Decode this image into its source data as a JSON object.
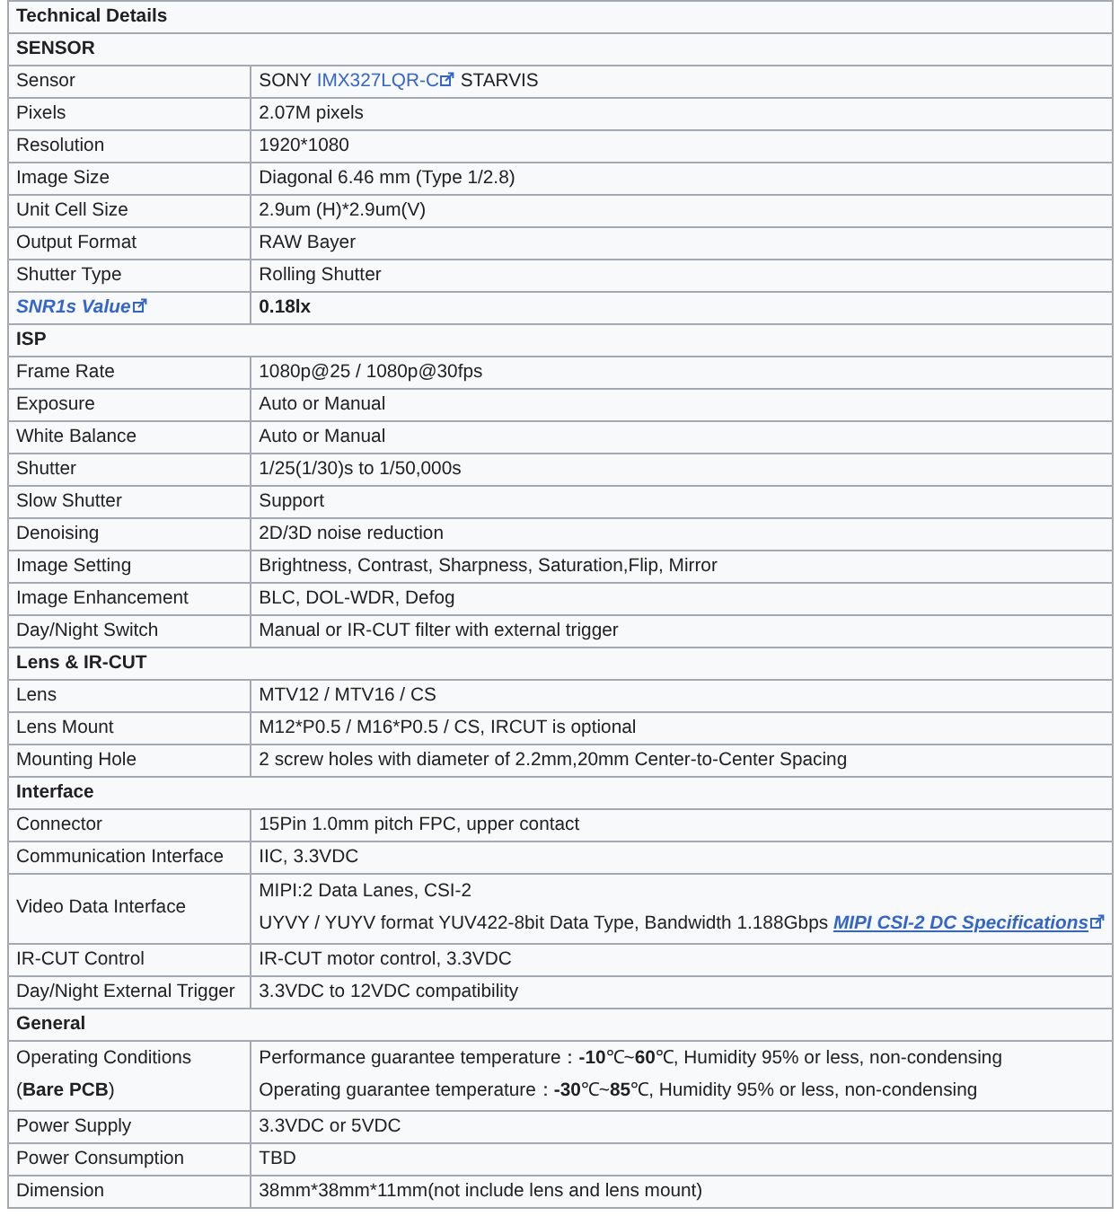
{
  "title": "Technical Details",
  "sections": [
    {
      "title": "SENSOR",
      "rows": [
        {
          "label": [
            [
              {
                "kind": "text",
                "text": "Sensor"
              }
            ]
          ],
          "value": [
            [
              {
                "kind": "text",
                "text": "SONY "
              },
              {
                "kind": "link",
                "text": "IMX327LQR-C"
              },
              {
                "kind": "text",
                "text": " STARVIS"
              }
            ]
          ]
        },
        {
          "label": [
            [
              {
                "kind": "text",
                "text": "Pixels"
              }
            ]
          ],
          "value": [
            [
              {
                "kind": "text",
                "text": "2.07M pixels"
              }
            ]
          ]
        },
        {
          "label": [
            [
              {
                "kind": "text",
                "text": "Resolution"
              }
            ]
          ],
          "value": [
            [
              {
                "kind": "text",
                "text": "1920*1080"
              }
            ]
          ]
        },
        {
          "label": [
            [
              {
                "kind": "text",
                "text": "Image Size"
              }
            ]
          ],
          "value": [
            [
              {
                "kind": "text",
                "text": "Diagonal 6.46 mm (Type 1/2.8)"
              }
            ]
          ]
        },
        {
          "label": [
            [
              {
                "kind": "text",
                "text": "Unit Cell Size"
              }
            ]
          ],
          "value": [
            [
              {
                "kind": "text",
                "text": "2.9um (H)*2.9um(V)"
              }
            ]
          ]
        },
        {
          "label": [
            [
              {
                "kind": "text",
                "text": "Output Format"
              }
            ]
          ],
          "value": [
            [
              {
                "kind": "text",
                "text": "RAW Bayer"
              }
            ]
          ]
        },
        {
          "label": [
            [
              {
                "kind": "text",
                "text": "Shutter Type"
              }
            ]
          ],
          "value": [
            [
              {
                "kind": "text",
                "text": "Rolling Shutter"
              }
            ]
          ]
        },
        {
          "label": [
            [
              {
                "kind": "link",
                "text": "SNR1s Value"
              }
            ]
          ],
          "value": [
            [
              {
                "kind": "text",
                "text": "**0.18lx**"
              }
            ]
          ]
        }
      ]
    },
    {
      "title": "ISP",
      "rows": [
        {
          "label": [
            [
              {
                "kind": "text",
                "text": "Frame Rate"
              }
            ]
          ],
          "value": [
            [
              {
                "kind": "text",
                "text": "1080p@25 / 1080p@30fps"
              }
            ]
          ]
        },
        {
          "label": [
            [
              {
                "kind": "text",
                "text": "Exposure"
              }
            ]
          ],
          "value": [
            [
              {
                "kind": "text",
                "text": "Auto or Manual"
              }
            ]
          ]
        },
        {
          "label": [
            [
              {
                "kind": "text",
                "text": "White Balance"
              }
            ]
          ],
          "value": [
            [
              {
                "kind": "text",
                "text": "Auto or Manual"
              }
            ]
          ]
        },
        {
          "label": [
            [
              {
                "kind": "text",
                "text": "Shutter"
              }
            ]
          ],
          "value": [
            [
              {
                "kind": "text",
                "text": "1/25(1/30)s to 1/50,000s"
              }
            ]
          ]
        },
        {
          "label": [
            [
              {
                "kind": "text",
                "text": "Slow Shutter"
              }
            ]
          ],
          "value": [
            [
              {
                "kind": "text",
                "text": "Support"
              }
            ]
          ]
        },
        {
          "label": [
            [
              {
                "kind": "text",
                "text": "Denoising"
              }
            ]
          ],
          "value": [
            [
              {
                "kind": "text",
                "text": "2D/3D noise reduction"
              }
            ]
          ]
        },
        {
          "label": [
            [
              {
                "kind": "text",
                "text": "Image Setting"
              }
            ]
          ],
          "value": [
            [
              {
                "kind": "text",
                "text": "Brightness, Contrast, Sharpness, Saturation,Flip, Mirror"
              }
            ]
          ]
        },
        {
          "label": [
            [
              {
                "kind": "text",
                "text": "Image Enhancement"
              }
            ]
          ],
          "value": [
            [
              {
                "kind": "text",
                "text": "BLC, DOL-WDR, Defog"
              }
            ]
          ]
        },
        {
          "label": [
            [
              {
                "kind": "text",
                "text": "Day/Night Switch"
              }
            ]
          ],
          "value": [
            [
              {
                "kind": "text",
                "text": "Manual or IR-CUT filter with external trigger"
              }
            ]
          ]
        }
      ]
    },
    {
      "title": "Lens & IR-CUT",
      "rows": [
        {
          "label": [
            [
              {
                "kind": "text",
                "text": "Lens"
              }
            ]
          ],
          "value": [
            [
              {
                "kind": "text",
                "text": "MTV12 / MTV16 / CS"
              }
            ]
          ]
        },
        {
          "label": [
            [
              {
                "kind": "text",
                "text": "Lens Mount"
              }
            ]
          ],
          "value": [
            [
              {
                "kind": "text",
                "text": "M12*P0.5 / M16*P0.5 / CS,  IRCUT is optional"
              }
            ]
          ]
        },
        {
          "label": [
            [
              {
                "kind": "text",
                "text": "Mounting Hole"
              }
            ]
          ],
          "value": [
            [
              {
                "kind": "text",
                "text": "2 screw holes with diameter of 2.2mm,20mm Center-to-Center Spacing"
              }
            ]
          ]
        }
      ]
    },
    {
      "title": "Interface",
      "rows": [
        {
          "label": [
            [
              {
                "kind": "text",
                "text": "Connector"
              }
            ]
          ],
          "value": [
            [
              {
                "kind": "text",
                "text": "15Pin 1.0mm pitch FPC, upper contact"
              }
            ]
          ]
        },
        {
          "label": [
            [
              {
                "kind": "text",
                "text": "Communication Interface"
              }
            ]
          ],
          "value": [
            [
              {
                "kind": "text",
                "text": "IIC, 3.3VDC"
              }
            ]
          ]
        },
        {
          "label": [
            [
              {
                "kind": "text",
                "text": "Video Data Interface"
              }
            ]
          ],
          "value": [
            [
              {
                "kind": "text",
                "text": "MIPI:2 Data Lanes, CSI-2"
              }
            ],
            [
              {
                "kind": "text",
                "text": "UYVY / YUYV format YUV422-8bit Data Type, Bandwidth 1.188Gbps "
              },
              {
                "kind": "link",
                "text": "MIPI CSI-2 DC Specifications"
              }
            ]
          ]
        },
        {
          "label": [
            [
              {
                "kind": "text",
                "text": "IR-CUT Control"
              }
            ]
          ],
          "value": [
            [
              {
                "kind": "text",
                "text": "IR-CUT motor control, 3.3VDC"
              }
            ]
          ]
        },
        {
          "label": [
            [
              {
                "kind": "text",
                "text": "Day/Night External Trigger"
              }
            ]
          ],
          "value": [
            [
              {
                "kind": "text",
                "text": "3.3VDC to 12VDC compatibility"
              }
            ]
          ]
        }
      ]
    },
    {
      "title": "General",
      "rows": [
        {
          "label": [
            [
              {
                "kind": "text",
                "text": "Operating Conditions"
              }
            ],
            [
              {
                "kind": "text",
                "text": "(**Bare PCB**)"
              }
            ]
          ],
          "value": [
            [
              {
                "kind": "text",
                "text": "Performance guarantee temperature：**-10**℃~**60**℃, Humidity 95% or less, non-condensing"
              }
            ],
            [
              {
                "kind": "text",
                "text": "Operating guarantee temperature：**-30**℃~**85**℃, Humidity 95% or less, non-condensing"
              }
            ]
          ]
        },
        {
          "label": [
            [
              {
                "kind": "text",
                "text": "Power Supply"
              }
            ]
          ],
          "value": [
            [
              {
                "kind": "text",
                "text": "3.3VDC or 5VDC"
              }
            ]
          ]
        },
        {
          "label": [
            [
              {
                "kind": "text",
                "text": "Power Consumption"
              }
            ]
          ],
          "value": [
            [
              {
                "kind": "text",
                "text": "TBD"
              }
            ]
          ]
        },
        {
          "label": [
            [
              {
                "kind": "text",
                "text": "Dimension"
              }
            ]
          ],
          "value": [
            [
              {
                "kind": "text",
                "text": "38mm*38mm*11mm(not include lens and lens mount)"
              }
            ]
          ]
        }
      ]
    }
  ]
}
